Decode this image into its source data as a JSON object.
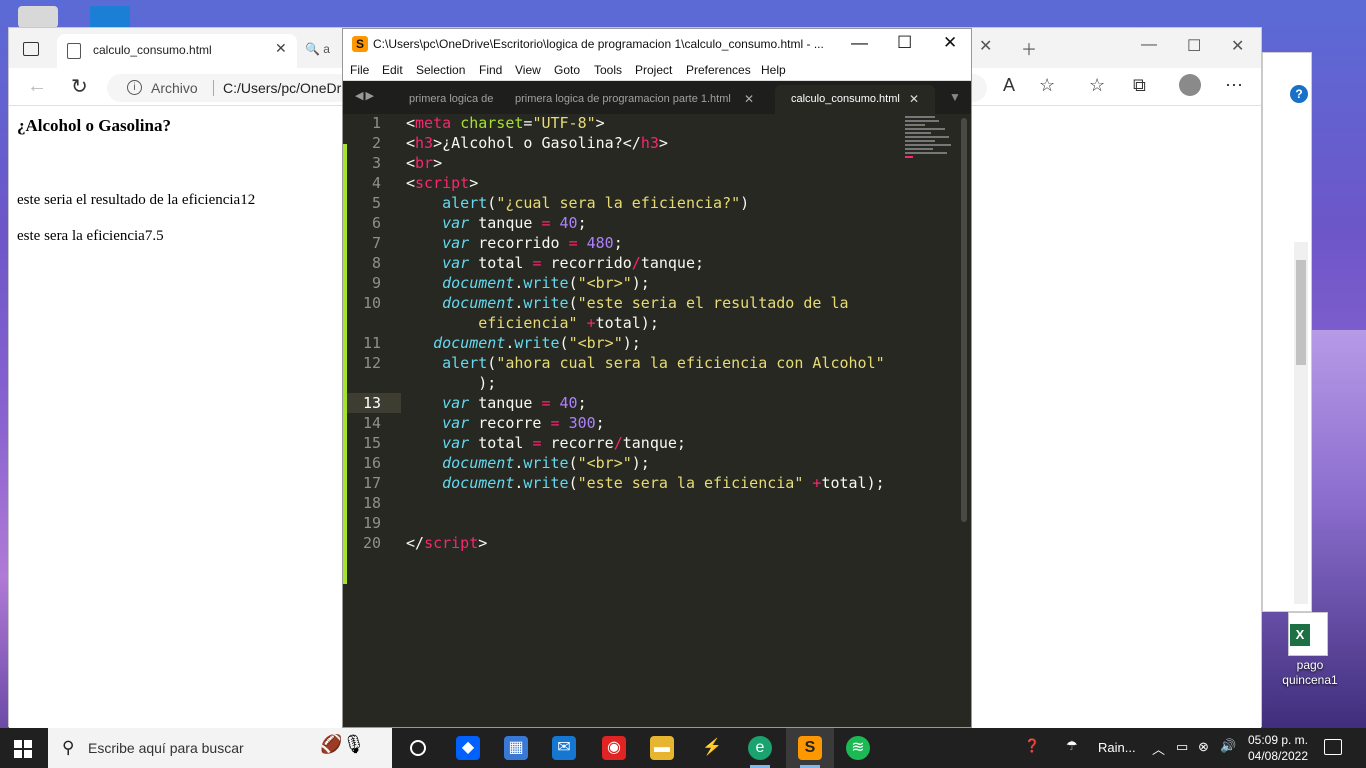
{
  "desktop": {
    "excel_icon_label_line1": "pago",
    "excel_icon_label_line2": "quincena1",
    "excel_badge": "X"
  },
  "browser": {
    "tab_title": "calculo_consumo.html",
    "tab2_title": "a",
    "address_label": "Archivo",
    "address_path": "C:/Users/pc/OneDri",
    "page": {
      "heading": "¿Alcohol o Gasolina?",
      "line1": "este seria el resultado de la eficiencia12",
      "line2": "este sera la eficiencia7.5"
    }
  },
  "sublime": {
    "window_title": "C:\\Users\\pc\\OneDrive\\Escritorio\\logica de programacion 1\\calculo_consumo.html - ...",
    "menu": [
      "File",
      "Edit",
      "Selection",
      "Find",
      "View",
      "Goto",
      "Tools",
      "Project",
      "Preferences",
      "Help"
    ],
    "tabs": [
      {
        "label": "primera logica de ’"
      },
      {
        "label": "primera logica de programacion parte 1.html"
      },
      {
        "label": "calculo_consumo.html"
      }
    ],
    "line_numbers": [
      "1",
      "2",
      "3",
      "4",
      "5",
      "6",
      "7",
      "8",
      "9",
      "10",
      "11",
      "12",
      "13",
      "14",
      "15",
      "16",
      "17",
      "18",
      "19",
      "20"
    ],
    "current_line": "13"
  },
  "taskbar": {
    "search_placeholder": "Escribe aquí para buscar",
    "weather_text": "Rain...",
    "time": "05:09 p. m.",
    "date": "04/08/2022"
  }
}
